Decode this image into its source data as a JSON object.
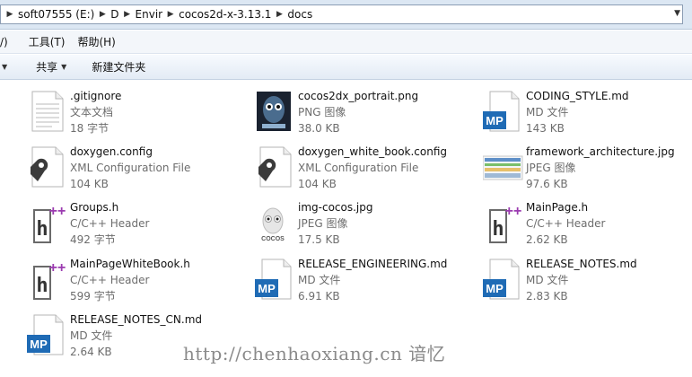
{
  "address": {
    "crumbs": [
      "soft07555 (E:)",
      "D",
      "Envir",
      "cocos2d-x-3.13.1",
      "docs"
    ]
  },
  "menubar": {
    "items": [
      "/)",
      "工具(T)",
      "帮助(H)"
    ]
  },
  "commandbar": {
    "share_label": "共享",
    "new_folder_label": "新建文件夹"
  },
  "files": [
    {
      "name": ".gitignore",
      "type": "文本文档",
      "size": "18 字节",
      "icon": "text-file-icon"
    },
    {
      "name": "cocos2dx_portrait.png",
      "type": "PNG 图像",
      "size": "38.0 KB",
      "icon": "image-thumbnail-icon"
    },
    {
      "name": "CODING_STYLE.md",
      "type": "MD 文件",
      "size": "143 KB",
      "icon": "markdown-file-icon"
    },
    {
      "name": "doxygen.config",
      "type": "XML Configuration File",
      "size": "104 KB",
      "icon": "config-file-icon"
    },
    {
      "name": "doxygen_white_book.config",
      "type": "XML Configuration File",
      "size": "104 KB",
      "icon": "config-file-icon"
    },
    {
      "name": "framework_architecture.jpg",
      "type": "JPEG 图像",
      "size": "97.6 KB",
      "icon": "image-thumbnail-icon"
    },
    {
      "name": "Groups.h",
      "type": "C/C++ Header",
      "size": "492 字节",
      "icon": "header-file-icon"
    },
    {
      "name": "img-cocos.jpg",
      "type": "JPEG 图像",
      "size": "17.5 KB",
      "icon": "image-thumbnail-icon"
    },
    {
      "name": "MainPage.h",
      "type": "C/C++ Header",
      "size": "2.62 KB",
      "icon": "header-file-icon"
    },
    {
      "name": "MainPageWhiteBook.h",
      "type": "C/C++ Header",
      "size": "599 字节",
      "icon": "header-file-icon"
    },
    {
      "name": "RELEASE_ENGINEERING.md",
      "type": "MD 文件",
      "size": "6.91 KB",
      "icon": "markdown-file-icon"
    },
    {
      "name": "RELEASE_NOTES.md",
      "type": "MD 文件",
      "size": "2.83 KB",
      "icon": "markdown-file-icon"
    },
    {
      "name": "RELEASE_NOTES_CN.md",
      "type": "MD 文件",
      "size": "2.64 KB",
      "icon": "markdown-file-icon"
    }
  ],
  "watermark": "http://chenhaoxiang.cn 谙忆",
  "colors": {
    "markdown_blue": "#1f6bb5",
    "header_purple": "#9b3bb0",
    "address_bg": "#dce7f3"
  }
}
